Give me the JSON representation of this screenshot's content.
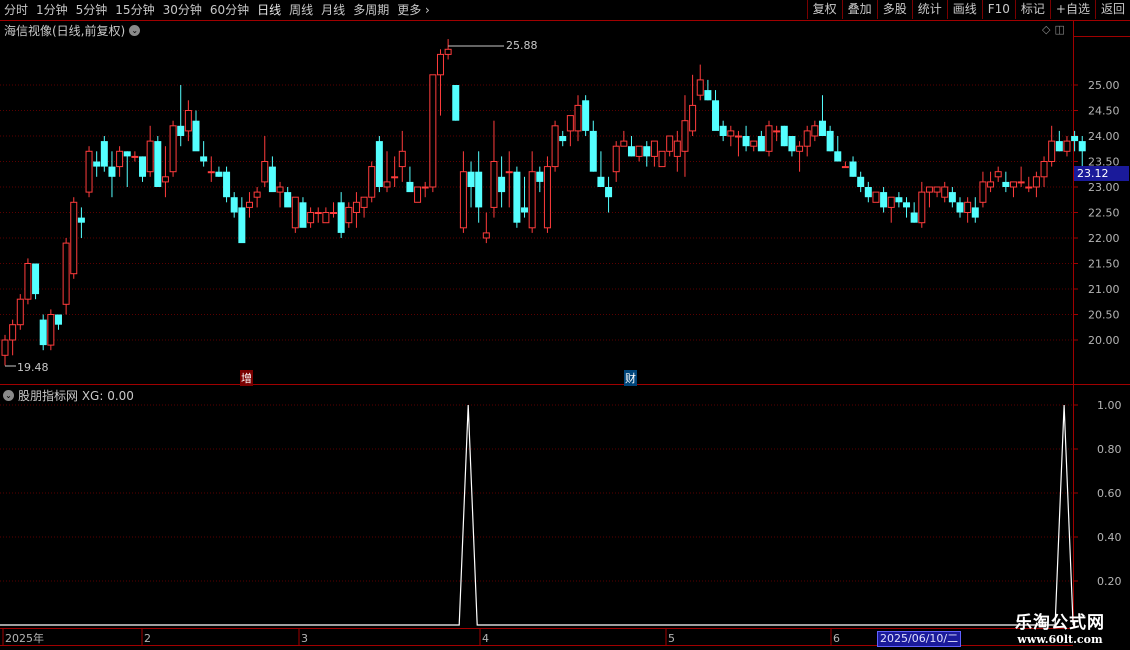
{
  "toolbar": {
    "periods": [
      "分时",
      "1分钟",
      "5分钟",
      "15分钟",
      "30分钟",
      "60分钟",
      "日线",
      "周线",
      "月线",
      "多周期",
      "更多"
    ],
    "active_period": "日线",
    "buttons": [
      "复权",
      "叠加",
      "多股",
      "统计",
      "画线",
      "F10",
      "标记",
      "+自选",
      "返回"
    ]
  },
  "main_chart": {
    "title": "海信视像(日线,前复权)",
    "price_labels": [
      "25.00",
      "24.50",
      "24.00",
      "23.50",
      "23.00",
      "22.50",
      "22.00",
      "21.50",
      "21.00",
      "20.50",
      "20.00"
    ],
    "current_price": "23.12",
    "max_label": "25.88",
    "min_label": "19.48",
    "signal_zeng": "增",
    "signal_cai": "财"
  },
  "indicator": {
    "title": "股朋指标网 XG: 0.00",
    "axis_labels": [
      "1.00",
      "0.80",
      "0.60",
      "0.40",
      "0.20"
    ]
  },
  "time_axis": {
    "labels": [
      "2025年",
      "2",
      "3",
      "4",
      "5",
      "6"
    ],
    "selected_date": "2025/06/10/二"
  },
  "watermark": {
    "title": "乐淘公式网",
    "url": "www.60lt.com"
  },
  "colors": {
    "up": "#ff3c3c",
    "down": "#54ffff",
    "grid": "#5a0000",
    "frame": "#a00000"
  },
  "chart_data": {
    "type": "candlestick",
    "y_range": [
      19.48,
      25.88
    ],
    "candles": [
      [
        19.7,
        20.1,
        19.5,
        20.0
      ],
      [
        20.0,
        20.4,
        19.7,
        20.3
      ],
      [
        20.3,
        20.9,
        20.2,
        20.8
      ],
      [
        20.8,
        21.6,
        20.7,
        21.5
      ],
      [
        21.5,
        21.5,
        20.8,
        20.9
      ],
      [
        20.4,
        20.5,
        19.8,
        19.9
      ],
      [
        19.9,
        20.6,
        19.8,
        20.5
      ],
      [
        20.5,
        20.5,
        20.2,
        20.3
      ],
      [
        20.7,
        22.0,
        20.5,
        21.9
      ],
      [
        21.3,
        22.8,
        21.2,
        22.7
      ],
      [
        22.4,
        22.6,
        22.0,
        22.3
      ],
      [
        22.9,
        23.8,
        22.8,
        23.7
      ],
      [
        23.5,
        23.7,
        23.2,
        23.4
      ],
      [
        23.9,
        24.0,
        23.3,
        23.4
      ],
      [
        23.4,
        23.7,
        22.8,
        23.2
      ],
      [
        23.4,
        23.8,
        23.2,
        23.7
      ],
      [
        23.7,
        23.7,
        23.0,
        23.6
      ],
      [
        23.6,
        23.7,
        23.5,
        23.6
      ],
      [
        23.6,
        23.6,
        23.1,
        23.2
      ],
      [
        23.3,
        24.2,
        23.2,
        23.9
      ],
      [
        23.9,
        24.0,
        23.3,
        23.0
      ],
      [
        23.1,
        23.8,
        22.8,
        23.2
      ],
      [
        23.3,
        24.3,
        23.2,
        24.2
      ],
      [
        24.2,
        25.0,
        23.8,
        24.0
      ],
      [
        24.1,
        24.7,
        23.9,
        24.5
      ],
      [
        24.3,
        24.5,
        23.8,
        23.7
      ],
      [
        23.6,
        23.9,
        23.4,
        23.5
      ],
      [
        23.3,
        23.6,
        23.1,
        23.3
      ],
      [
        23.3,
        23.4,
        23.2,
        23.2
      ],
      [
        23.3,
        23.4,
        22.7,
        22.8
      ],
      [
        22.8,
        22.9,
        22.4,
        22.5
      ],
      [
        22.6,
        22.8,
        22.0,
        21.9
      ],
      [
        22.6,
        22.9,
        22.4,
        22.7
      ],
      [
        22.8,
        23.0,
        22.6,
        22.9
      ],
      [
        23.1,
        24.0,
        23.0,
        23.5
      ],
      [
        23.4,
        23.6,
        23.0,
        22.9
      ],
      [
        22.9,
        23.1,
        22.6,
        23.0
      ],
      [
        22.9,
        23.0,
        22.7,
        22.6
      ],
      [
        22.2,
        22.8,
        22.1,
        22.8
      ],
      [
        22.7,
        22.8,
        22.3,
        22.2
      ],
      [
        22.3,
        22.6,
        22.2,
        22.5
      ],
      [
        22.5,
        22.6,
        22.3,
        22.5
      ],
      [
        22.3,
        22.6,
        22.3,
        22.5
      ],
      [
        22.5,
        22.7,
        22.4,
        22.5
      ],
      [
        22.7,
        22.9,
        22.0,
        22.1
      ],
      [
        22.3,
        22.7,
        22.2,
        22.6
      ],
      [
        22.5,
        22.9,
        22.2,
        22.7
      ],
      [
        22.6,
        22.8,
        22.4,
        22.8
      ],
      [
        22.8,
        23.5,
        22.7,
        23.4
      ],
      [
        23.9,
        24.0,
        22.9,
        23.0
      ],
      [
        23.0,
        23.7,
        22.9,
        23.1
      ],
      [
        23.2,
        23.6,
        23.0,
        23.2
      ],
      [
        23.4,
        24.1,
        23.1,
        23.7
      ],
      [
        23.1,
        23.4,
        23.1,
        22.9
      ],
      [
        22.7,
        23.0,
        22.7,
        23.0
      ],
      [
        23.0,
        23.1,
        22.8,
        23.0
      ],
      [
        23.0,
        25.0,
        22.9,
        25.2
      ],
      [
        25.2,
        25.7,
        24.4,
        25.6
      ],
      [
        25.6,
        25.9,
        25.5,
        25.7
      ],
      [
        25.0,
        25.0,
        24.3,
        24.3
      ],
      [
        22.2,
        23.7,
        22.1,
        23.3
      ],
      [
        23.3,
        23.5,
        22.6,
        23.0
      ],
      [
        23.3,
        23.7,
        22.3,
        22.6
      ],
      [
        22.0,
        22.5,
        21.9,
        22.1
      ],
      [
        22.6,
        24.3,
        22.4,
        23.5
      ],
      [
        23.2,
        23.6,
        22.6,
        22.9
      ],
      [
        23.3,
        23.7,
        22.6,
        23.3
      ],
      [
        23.3,
        23.4,
        22.2,
        22.3
      ],
      [
        22.6,
        23.2,
        22.4,
        22.5
      ],
      [
        22.2,
        23.7,
        22.1,
        23.3
      ],
      [
        23.3,
        23.4,
        22.9,
        23.1
      ],
      [
        22.2,
        23.6,
        22.1,
        23.4
      ],
      [
        23.4,
        24.3,
        23.3,
        24.2
      ],
      [
        24.0,
        24.1,
        23.8,
        23.9
      ],
      [
        24.1,
        24.3,
        23.8,
        24.4
      ],
      [
        24.1,
        24.8,
        23.9,
        24.6
      ],
      [
        24.7,
        24.8,
        24.0,
        24.1
      ],
      [
        24.1,
        24.3,
        23.3,
        23.3
      ],
      [
        23.2,
        23.7,
        23.0,
        23.0
      ],
      [
        23.0,
        23.2,
        22.5,
        22.8
      ],
      [
        23.3,
        23.9,
        23.1,
        23.8
      ],
      [
        23.8,
        24.1,
        23.8,
        23.9
      ],
      [
        23.8,
        24.0,
        23.6,
        23.6
      ],
      [
        23.6,
        23.8,
        23.5,
        23.8
      ],
      [
        23.8,
        23.9,
        23.4,
        23.6
      ],
      [
        23.6,
        23.9,
        23.4,
        23.9
      ],
      [
        23.4,
        23.7,
        23.4,
        23.7
      ],
      [
        23.7,
        24.0,
        23.6,
        24.0
      ],
      [
        23.6,
        24.1,
        23.3,
        23.9
      ],
      [
        23.7,
        24.8,
        23.2,
        24.3
      ],
      [
        24.1,
        25.2,
        24.0,
        24.6
      ],
      [
        24.8,
        25.4,
        24.7,
        25.1
      ],
      [
        24.9,
        25.1,
        24.7,
        24.7
      ],
      [
        24.7,
        24.9,
        24.3,
        24.1
      ],
      [
        24.2,
        24.3,
        23.9,
        24.0
      ],
      [
        24.0,
        24.2,
        23.8,
        24.1
      ],
      [
        24.0,
        24.1,
        23.6,
        24.0
      ],
      [
        24.0,
        24.2,
        23.7,
        23.8
      ],
      [
        23.8,
        23.9,
        23.7,
        23.9
      ],
      [
        24.0,
        24.1,
        23.8,
        23.7
      ],
      [
        23.7,
        24.3,
        23.6,
        24.2
      ],
      [
        24.1,
        24.2,
        23.9,
        24.1
      ],
      [
        24.2,
        24.2,
        23.8,
        23.8
      ],
      [
        24.0,
        24.0,
        23.6,
        23.7
      ],
      [
        23.7,
        23.9,
        23.3,
        23.8
      ],
      [
        23.8,
        24.2,
        23.6,
        24.1
      ],
      [
        24.0,
        24.3,
        23.9,
        24.2
      ],
      [
        24.3,
        24.8,
        24.2,
        24.0
      ],
      [
        24.1,
        24.2,
        23.7,
        23.7
      ],
      [
        23.7,
        24.0,
        23.5,
        23.5
      ],
      [
        23.4,
        23.5,
        23.4,
        23.4
      ],
      [
        23.5,
        23.6,
        23.2,
        23.2
      ],
      [
        23.2,
        23.3,
        22.9,
        23.0
      ],
      [
        23.0,
        23.1,
        22.7,
        22.8
      ],
      [
        22.7,
        22.9,
        22.7,
        22.9
      ],
      [
        22.9,
        23.0,
        22.5,
        22.6
      ],
      [
        22.6,
        22.8,
        22.3,
        22.8
      ],
      [
        22.8,
        22.9,
        22.6,
        22.7
      ],
      [
        22.7,
        22.8,
        22.4,
        22.6
      ],
      [
        22.5,
        22.7,
        22.3,
        22.3
      ],
      [
        22.3,
        23.1,
        22.2,
        22.9
      ],
      [
        22.9,
        23.0,
        22.6,
        23.0
      ],
      [
        22.9,
        23.0,
        22.8,
        23.0
      ],
      [
        22.8,
        23.1,
        22.7,
        23.0
      ],
      [
        22.9,
        23.0,
        22.6,
        22.7
      ],
      [
        22.7,
        22.8,
        22.4,
        22.5
      ],
      [
        22.5,
        22.8,
        22.3,
        22.7
      ],
      [
        22.6,
        22.8,
        22.3,
        22.4
      ],
      [
        22.7,
        23.3,
        22.6,
        23.1
      ],
      [
        23.0,
        23.3,
        22.9,
        23.1
      ],
      [
        23.2,
        23.4,
        23.1,
        23.3
      ],
      [
        23.1,
        23.3,
        22.9,
        23.0
      ],
      [
        23.0,
        23.1,
        22.8,
        23.1
      ],
      [
        23.1,
        23.4,
        23.0,
        23.1
      ],
      [
        23.0,
        23.2,
        22.9,
        23.0
      ],
      [
        23.0,
        23.3,
        22.8,
        23.2
      ],
      [
        23.2,
        23.6,
        23.0,
        23.5
      ],
      [
        23.5,
        24.2,
        23.4,
        23.9
      ],
      [
        23.9,
        24.1,
        23.7,
        23.7
      ],
      [
        23.7,
        24.0,
        23.6,
        23.9
      ],
      [
        24.0,
        24.1,
        23.7,
        23.9
      ],
      [
        23.9,
        24.0,
        23.3,
        23.7
      ]
    ],
    "xg_indicator": {
      "range": [
        0,
        1
      ],
      "spikes_at_index": [
        55,
        133
      ],
      "values": "0 except 1.00 at spikes"
    }
  }
}
